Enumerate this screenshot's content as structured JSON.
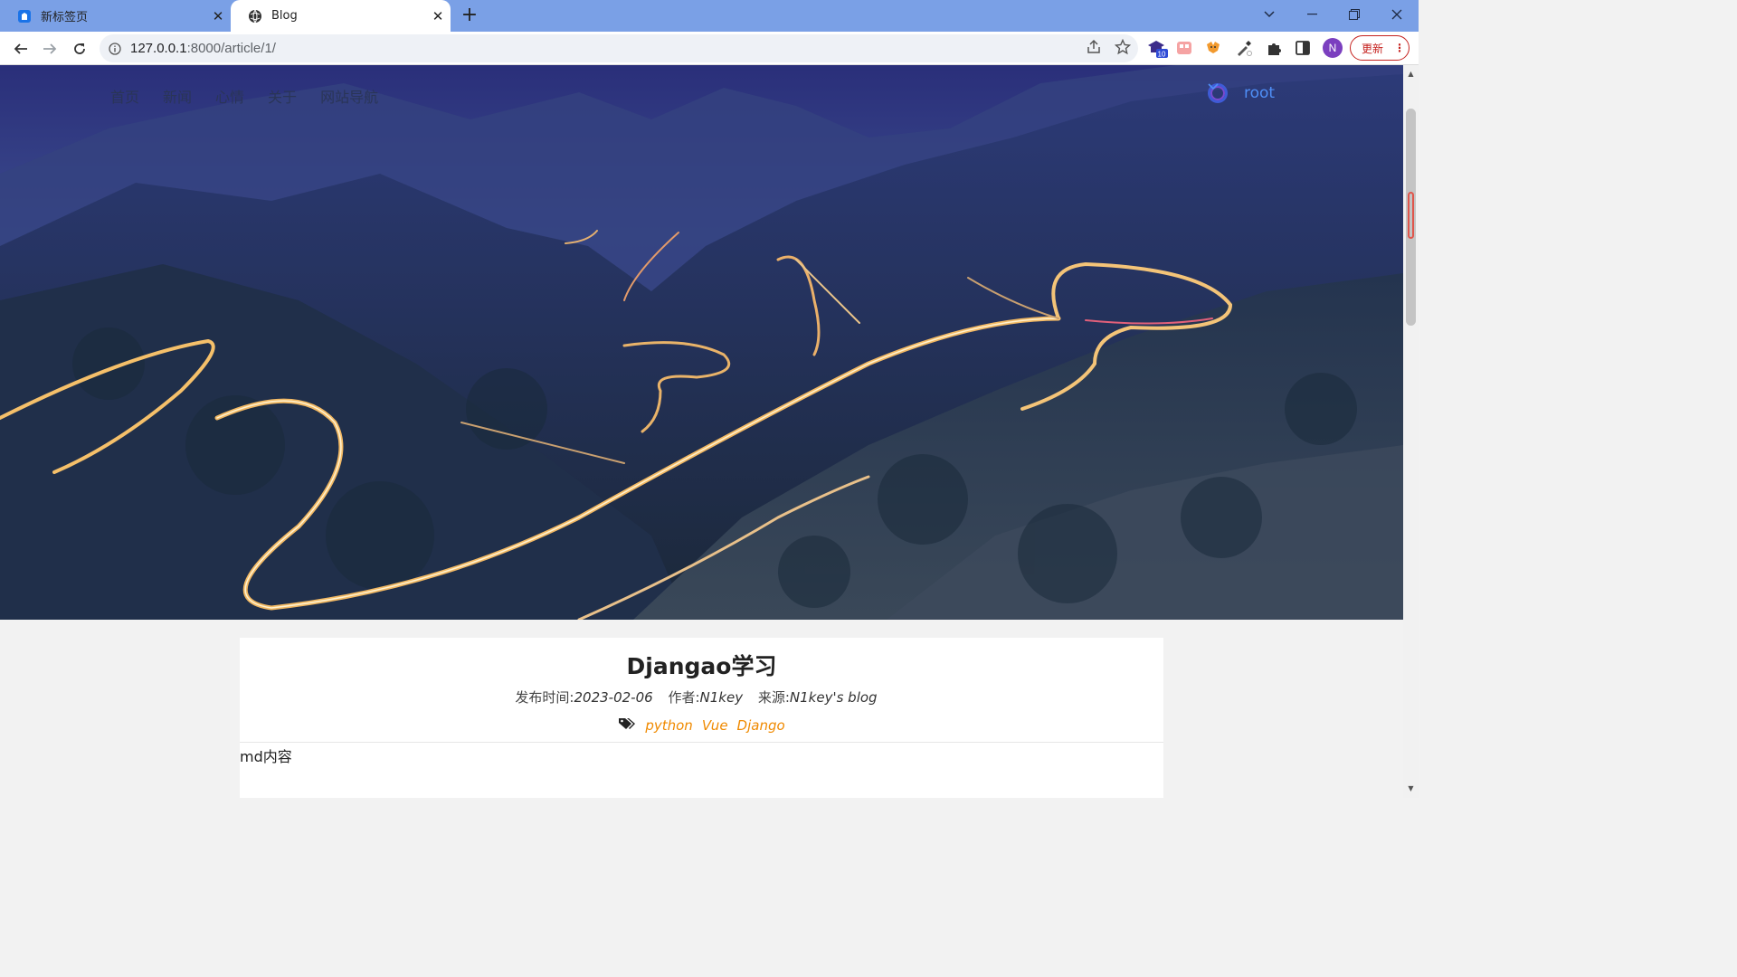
{
  "browser": {
    "tabs": [
      {
        "title": "新标签页",
        "close": "✕"
      },
      {
        "title": "Blog",
        "close": "✕"
      }
    ],
    "new_tab": "+",
    "url_host": "127.0.0.1",
    "url_path": ":8000/article/1/",
    "extension_badge": "10",
    "profile_initial": "N",
    "update_label": "更新",
    "update_menu": "⋮"
  },
  "site": {
    "nav": [
      "首页",
      "新闻",
      "心情",
      "关于",
      "网站导航"
    ],
    "user": "root"
  },
  "article": {
    "title": "Djangao学习",
    "published_label": "发布时间:",
    "published": "2023-02-06",
    "author_label": "作者:",
    "author": "N1key",
    "source_label": "来源:",
    "source": "N1key's blog",
    "tags": [
      "python",
      "Vue",
      "Django"
    ],
    "body": "md内容"
  }
}
